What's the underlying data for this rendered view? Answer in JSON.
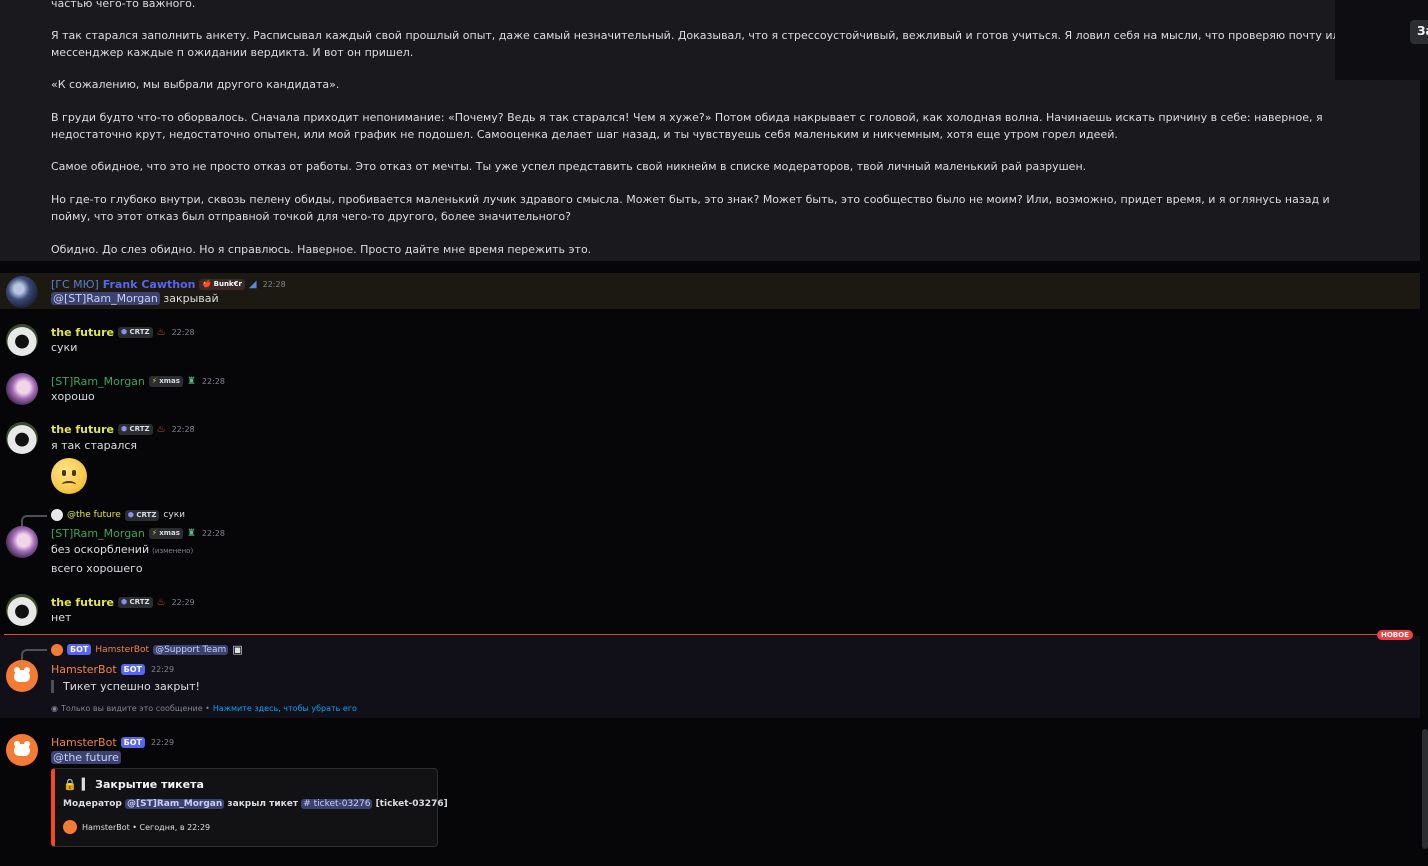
{
  "long_message": {
    "paragraphs": [
      "частью чего-то важного.",
      "Я так старался заполнить анкету. Расписывал каждый свой прошлый опыт, даже самый незначительный. Доказывал, что я стрессоустойчивый, вежливый и готов учиться. Я ловил себя на мысли, что проверяю почту или мессенджер каждые п ожидании вердикта. И вот он пришел.",
      "«К сожалению, мы выбрали другого кандидата».",
      "В груди будто что-то оборвалось. Сначала приходит непонимание: «Почему? Ведь я так старался! Чем я хуже?» Потом обида накрывает с головой, как холодная волна. Начинаешь искать причину в себе: наверное, я недостаточно крут, недостаточно опытен, или мой график не подошел. Самооценка делает шаг назад, и ты чувствуешь себя маленьким и никчемным, хотя еще утром горел идеей.",
      "Самое обидное, что это не просто отказ от работы. Это отказ от мечты. Ты уже успел представить свой никнейм в списке модераторов, твой личный маленький рай разрушен.",
      "Но где-то глубоко внутри, сквозь пелену обиды, пробивается маленький лучик здравого смысла. Может быть, это знак? Может быть, это сообщество было не моим? Или, возможно, придет время, и я оглянусь назад и пойму, что этот отказ был отправной точкой для чего-то другого, более значительного?",
      "Обидно. До слез обидно. Но я справлюсь. Наверное. Просто дайте мне время пережить это."
    ]
  },
  "corner_button": "За",
  "messages": {
    "frank": {
      "name_prefix": "[ГС МЮ]",
      "name": "Frank Cawthon",
      "tag": "Bunk€r",
      "time": "22:28",
      "mention": "@[ST]Ram_Morgan",
      "text": "закрывай"
    },
    "future1": {
      "name": "the future",
      "tag": "CRTZ",
      "time": "22:28",
      "text": "суки"
    },
    "ram1": {
      "name": "[ST]Ram_Morgan",
      "tag": "xmas",
      "time": "22:28",
      "text": "хорошо"
    },
    "future2": {
      "name": "the future",
      "tag": "CRTZ",
      "time": "22:28",
      "text": "я так старался"
    },
    "ram2": {
      "reply_name": "@the future",
      "reply_tag": "CRTZ",
      "reply_text": "суки",
      "name": "[ST]Ram_Morgan",
      "tag": "xmas",
      "time": "22:28",
      "text1": "без оскорблений",
      "edited": "(изменено)",
      "text2": "всего хорошего"
    },
    "future3": {
      "name": "the future",
      "tag": "CRTZ",
      "time": "22:29",
      "text": "нет"
    },
    "new_badge": "НОВОЕ",
    "hamster1": {
      "reply_tag": "БОТ",
      "reply_name": "HamsterBot",
      "reply_mention": "@Support Team",
      "name": "HamsterBot",
      "tag": "БОТ",
      "time": "22:29",
      "quote": "Тикет успешно закрыт!",
      "ephemeral": "Только вы видите это сообщение •",
      "ephemeral_link": "Нажмите здесь, чтобы убрать его"
    },
    "hamster2": {
      "name": "HamsterBot",
      "tag": "БОТ",
      "time": "22:29",
      "mention": "@the future",
      "embed": {
        "title": "Закрытие тикета",
        "desc_prefix": "Модератор",
        "moderator": "@[ST]Ram_Morgan",
        "desc_mid": "закрыл тикет",
        "channel": "# ticket-03276",
        "desc_suffix": "[ticket-03276]",
        "footer": "HamsterBot • Сегодня, в 22:29"
      }
    }
  },
  "colors": {
    "future": "#e3e64a",
    "ram": "#3ba55d",
    "frank": "#5865f2",
    "hamster": "#f0824a",
    "new_divider": "#f23f43"
  }
}
